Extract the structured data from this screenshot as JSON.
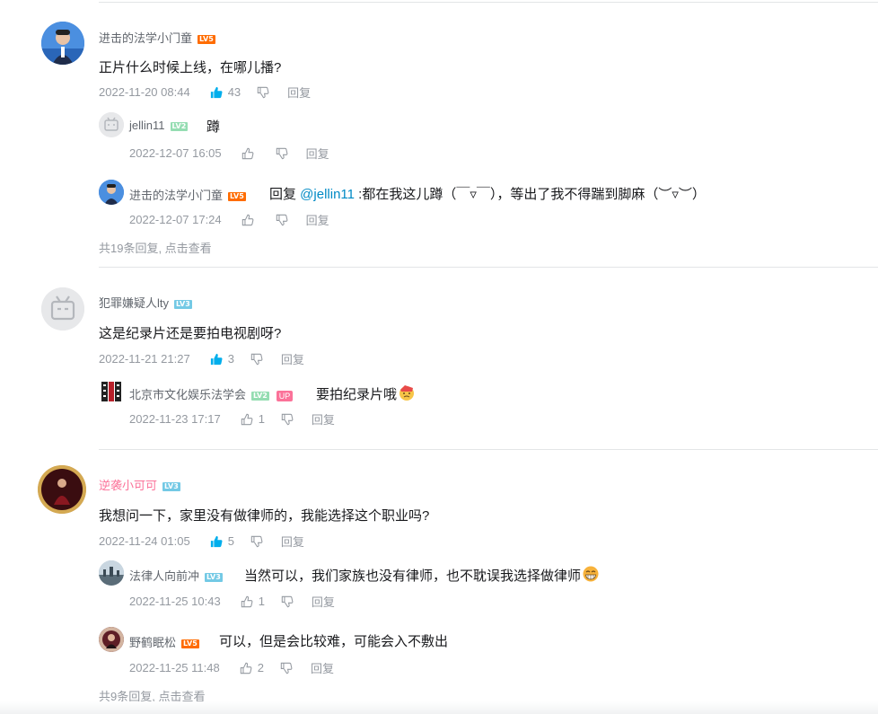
{
  "threads": [
    {
      "user": "进击的法学小门童",
      "level": "LV5",
      "content": "正片什么时候上线，在哪儿播?",
      "time": "2022-11-20 08:44",
      "likes": "43",
      "reply_label": "回复",
      "replies": [
        {
          "user": "jellin11",
          "level": "LV2",
          "content": "蹲",
          "time": "2022-12-07 16:05",
          "likes": "",
          "reply_label": "回复"
        },
        {
          "user": "进击的法学小门童",
          "level": "LV5",
          "prefix": "回复 ",
          "at": "@jellin11",
          "content": " :都在我这儿蹲（￣▿￣），等出了我不得踹到脚麻（︶▿︶）",
          "time": "2022-12-07 17:24",
          "likes": "",
          "reply_label": "回复"
        }
      ],
      "more": "共19条回复, 点击查看"
    },
    {
      "user": "犯罪嫌疑人lty",
      "level": "LV3",
      "content": "这是纪录片还是要拍电视剧呀?",
      "time": "2022-11-21 21:27",
      "likes": "3",
      "reply_label": "回复",
      "replies": [
        {
          "user": "北京市文化娱乐法学会",
          "level": "LV2",
          "badge": "UP",
          "content": "要拍纪录片哦",
          "emoji": "emoji-face-icon",
          "time": "2022-11-23 17:17",
          "likes": "1",
          "reply_label": "回复"
        }
      ]
    },
    {
      "user": "逆袭小可可",
      "level": "LV3",
      "content": "我想问一下，家里没有做律师的，我能选择这个职业吗?",
      "time": "2022-11-24 01:05",
      "likes": "5",
      "reply_label": "回复",
      "replies": [
        {
          "user": "法律人向前冲",
          "level": "LV3",
          "content": "当然可以，我们家族也没有律师，也不耽误我选择做律师",
          "emoji": "grin-face-icon",
          "time": "2022-11-25 10:43",
          "likes": "1",
          "reply_label": "回复"
        },
        {
          "user": "野鹤眠松",
          "level": "LV5",
          "content": "可以，但是会比较难，可能会入不敷出",
          "time": "2022-11-25 11:48",
          "likes": "2",
          "reply_label": "回复"
        }
      ],
      "more": "共9条回复, 点击查看"
    }
  ],
  "colors": {
    "accent_blue": "#00aeec",
    "link": "#008ac5",
    "pink_name": "#fb7299",
    "lv5": "#ff6c00",
    "lv3": "#73c9e5",
    "lv2": "#95ddb2"
  }
}
